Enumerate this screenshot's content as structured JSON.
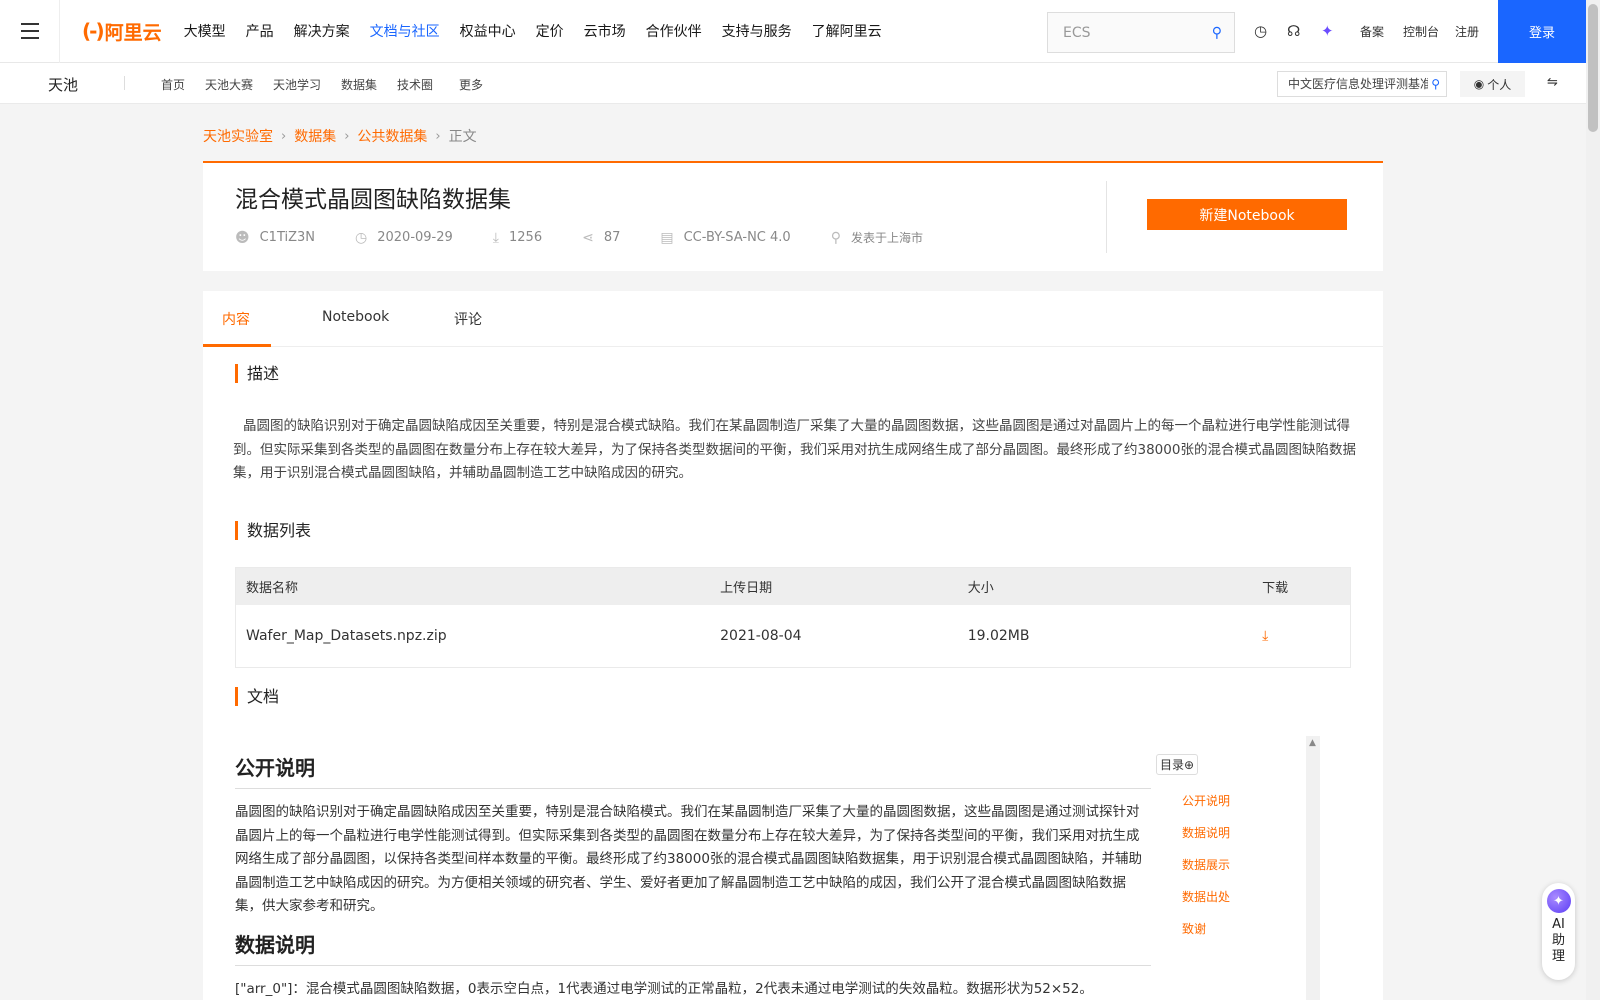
{
  "topnav": {
    "logo_text": "阿里云",
    "items": [
      "大模型",
      "产品",
      "解决方案",
      "文档与社区",
      "权益中心",
      "定价",
      "云市场",
      "合作伙伴",
      "支持与服务",
      "了解阿里云"
    ],
    "active_item": "文档与社区",
    "search_placeholder": "ECS",
    "links": {
      "beian": "备案",
      "console": "控制台",
      "register": "注册"
    },
    "login": "登录"
  },
  "subnav": {
    "brand": "天池",
    "items": [
      "首页",
      "天池大赛",
      "天池学习",
      "数据集",
      "技术圈",
      "更多"
    ],
    "search_value": "中文医疗信息处理评测基准",
    "personal": "个人"
  },
  "breadcrumb": [
    "天池实验室",
    "数据集",
    "公共数据集",
    "正文"
  ],
  "dataset": {
    "title": "混合模式晶圆图缺陷数据集",
    "author": "C1TiZ3N",
    "date": "2020-09-29",
    "downloads": "1256",
    "shares": "87",
    "license": "CC-BY-SA-NC 4.0",
    "location": "发表于上海市",
    "new_notebook": "新建Notebook"
  },
  "tabs": [
    "内容",
    "Notebook",
    "评论"
  ],
  "sections": {
    "desc_title": "描述",
    "desc_text": "晶圆图的缺陷识别对于确定晶圆缺陷成因至关重要，特别是混合模式缺陷。我们在某晶圆制造厂采集了大量的晶圆图数据，这些晶圆图是通过对晶圆片上的每一个晶粒进行电学性能测试得到。但实际采集到各类型的晶圆图在数量分布上存在较大差异，为了保持各类型数据间的平衡，我们采用对抗生成网络生成了部分晶圆图。最终形成了约38000张的混合模式晶圆图缺陷数据集，用于识别混合模式晶圆图缺陷，并辅助晶圆制造工艺中缺陷成因的研究。",
    "list_title": "数据列表",
    "doc_title": "文档"
  },
  "table": {
    "headers": [
      "数据名称",
      "上传日期",
      "大小",
      "下载"
    ],
    "rows": [
      {
        "name": "Wafer_Map_Datasets.npz.zip",
        "date": "2021-08-04",
        "size": "19.02MB"
      }
    ]
  },
  "doc": {
    "h_public": "公开说明",
    "p_public": "晶圆图的缺陷识别对于确定晶圆缺陷成因至关重要，特别是混合缺陷模式。我们在某晶圆制造厂采集了大量的晶圆图数据，这些晶圆图是通过测试探针对晶圆片上的每一个晶粒进行电学性能测试得到。但实际采集到各类型的晶圆图在数量分布上存在较大差异，为了保持各类型间的平衡，我们采用对抗生成网络生成了部分晶圆图，以保持各类型间样本数量的平衡。最终形成了约38000张的混合模式晶圆图缺陷数据集，用于识别混合模式晶圆图缺陷，并辅助晶圆制造工艺中缺陷成因的研究。为方便相关领域的研究者、学生、爱好者更加了解晶圆制造工艺中缺陷的成因，我们公开了混合模式晶圆图缺陷数据集，供大家参考和研究。",
    "h_data": "数据说明",
    "p_data": "[\"arr_0\"]：混合模式晶圆图缺陷数据，0表示空白点，1代表通过电学测试的正常晶粒，2代表未通过电学测试的失效晶粒。数据形状为52×52。",
    "toc_label": "目录",
    "toc": [
      "公开说明",
      "数据说明",
      "数据展示",
      "数据出处",
      "致谢"
    ]
  },
  "ai": {
    "label": "AI助理"
  },
  "colors": {
    "accent": "#ff6a00",
    "brand_blue": "#1a66ff"
  }
}
